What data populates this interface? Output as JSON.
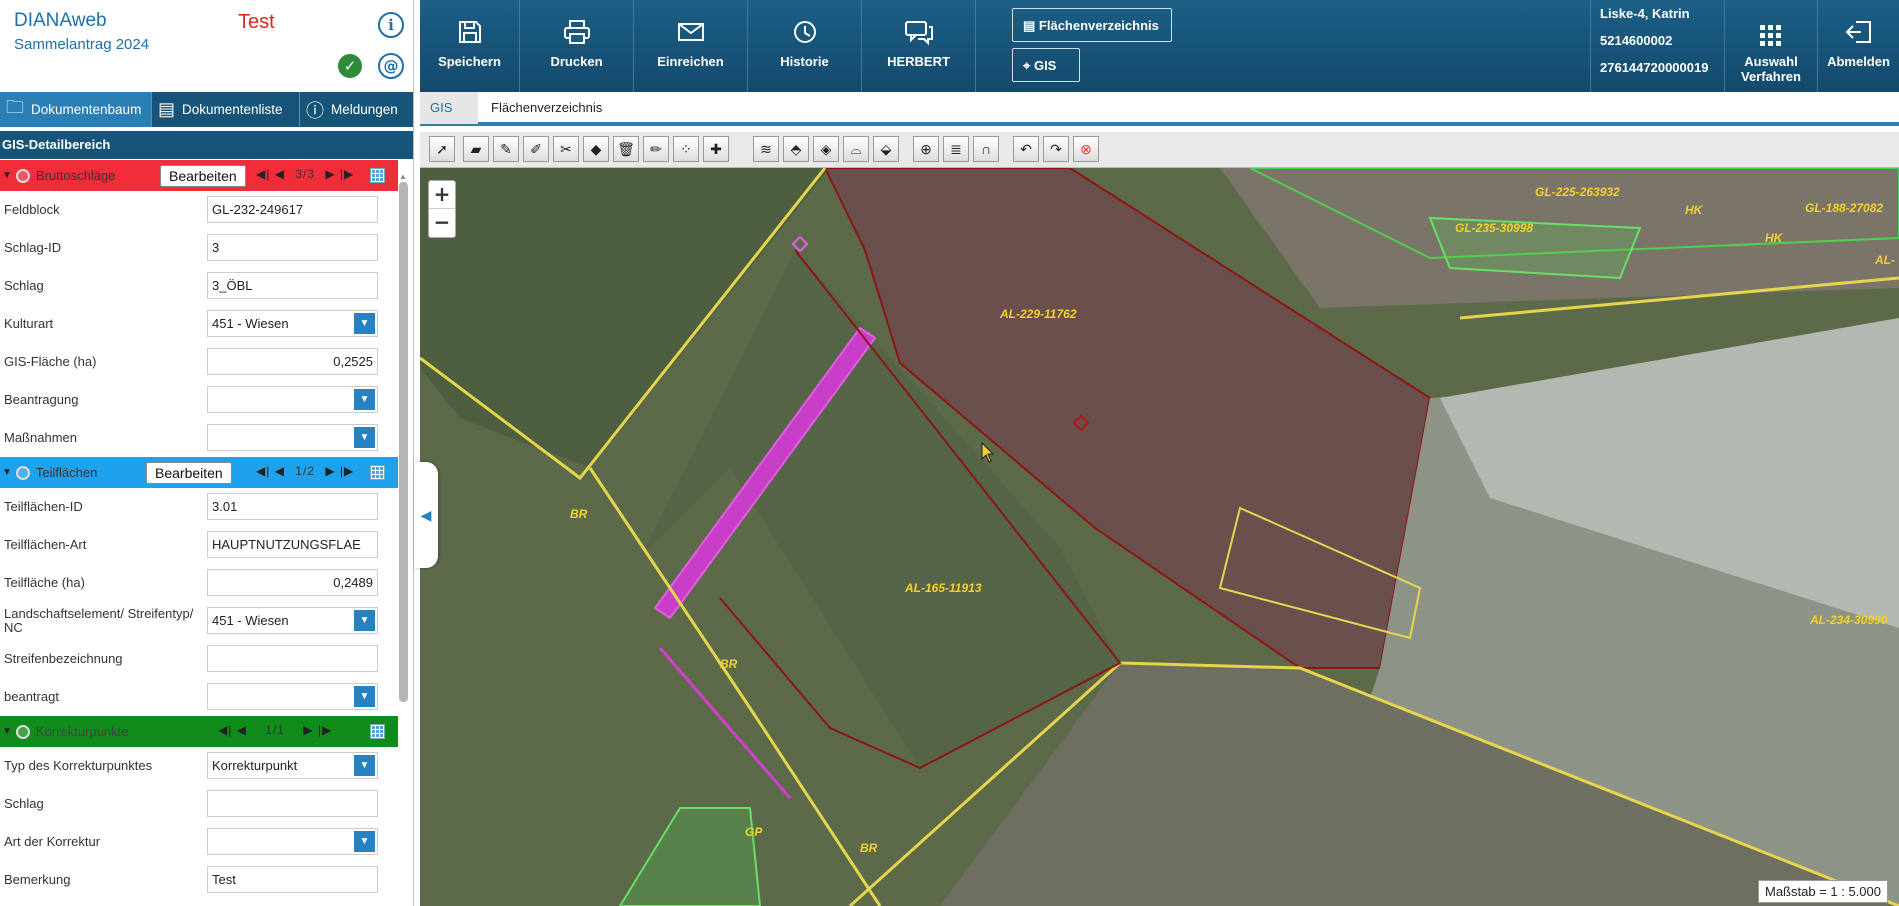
{
  "app": {
    "name": "DIANAweb",
    "subtitle": "Sammelantrag 2024",
    "env": "Test"
  },
  "status_icons": [
    "info-icon",
    "check-icon",
    "at-icon"
  ],
  "doc_tabs": [
    {
      "label": "Dokumentenbaum",
      "icon": "folder-icon"
    },
    {
      "label": "Dokumentenliste",
      "icon": "document-icon"
    },
    {
      "label": "Meldungen",
      "icon": "alert-icon"
    }
  ],
  "detail_header": "GIS-Detailbereich",
  "sections": {
    "brutto": {
      "title": "Bruttoschläge",
      "edit": "Bearbeiten",
      "count": "3/3",
      "fields": [
        {
          "label": "Feldblock",
          "value": "GL-232-249617"
        },
        {
          "label": "Schlag-ID",
          "value": "3"
        },
        {
          "label": "Schlag",
          "value": "3_ÖBL"
        },
        {
          "label": "Kulturart",
          "value": "451 - Wiesen"
        },
        {
          "label": "GIS-Fläche (ha)",
          "value": "0,2525"
        },
        {
          "label": "Beantragung",
          "value": ""
        },
        {
          "label": "Maßnahmen",
          "value": ""
        }
      ]
    },
    "teil": {
      "title": "Teilflächen",
      "edit": "Bearbeiten",
      "count": "1/2",
      "fields": [
        {
          "label": "Teilflächen-ID",
          "value": "3.01"
        },
        {
          "label": "Teilflächen-Art",
          "value": "HAUPTNUTZUNGSFLAE"
        },
        {
          "label": "Teilfläche (ha)",
          "value": "0,2489"
        },
        {
          "label": "Landschaftselement/ Streifentyp/ NC",
          "value": "451 - Wiesen"
        },
        {
          "label": "Streifenbezeichnung",
          "value": ""
        },
        {
          "label": "beantragt",
          "value": ""
        }
      ]
    },
    "korr": {
      "title": "Korrekturpunkte",
      "count": "1/1",
      "fields": [
        {
          "label": "Typ des Korrekturpunktes",
          "value": "Korrekturpunkt"
        },
        {
          "label": "Schlag",
          "value": ""
        },
        {
          "label": "Art der Korrektur",
          "value": ""
        },
        {
          "label": "Bemerkung",
          "value": "Test"
        }
      ]
    }
  },
  "top_buttons": [
    {
      "label": "Speichern",
      "icon": "save-icon"
    },
    {
      "label": "Drucken",
      "icon": "print-icon"
    },
    {
      "label": "Einreichen",
      "icon": "send-mail-icon"
    },
    {
      "label": "Historie",
      "icon": "history-icon"
    },
    {
      "label": "HERBERT",
      "icon": "chat-icon"
    }
  ],
  "view_buttons": [
    {
      "label": "Flächenverzeichnis",
      "icon": "document-icon"
    },
    {
      "label": "GIS",
      "icon": "location-pin-icon"
    }
  ],
  "user": {
    "name": "Liske-4, Katrin",
    "id1": "5214600002",
    "id2": "276144720000019"
  },
  "right_buttons": [
    {
      "label_1": "Auswahl",
      "label_2": "Verfahren",
      "icon": "grid-icon"
    },
    {
      "label": "Abmelden",
      "icon": "logout-icon"
    }
  ],
  "sub_tabs": [
    "GIS",
    "Flächenverzeichnis"
  ],
  "map": {
    "labels": [
      "AL-229-11762",
      "AL-165-11913",
      "AL-234-30990",
      "GL-225-263932",
      "GL-235-30998",
      "GL-188-27082",
      "AL-",
      "BR",
      "BR",
      "BR",
      "HK",
      "HK",
      "GP"
    ],
    "zoom_in": "+",
    "zoom_out": "−",
    "scale": "Maßstab = 1 : 5.000"
  }
}
